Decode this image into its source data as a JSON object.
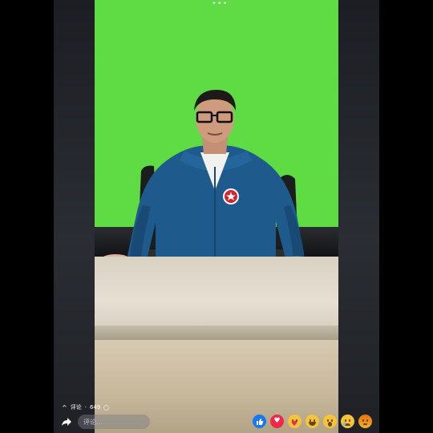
{
  "stats": {
    "chevron": "^",
    "comments_label": "评论",
    "separator": "·",
    "count": "649"
  },
  "comment_input": {
    "placeholder": "评论..."
  },
  "icons": {
    "menu": "more-dots-icon",
    "share": "share-arrow-icon",
    "reactions": [
      "like-icon",
      "love-icon",
      "care-icon",
      "haha-icon",
      "wow-icon",
      "sad-icon",
      "angry-icon"
    ]
  },
  "colors": {
    "green_screen": "#5fdb44",
    "like": "#1877f2",
    "love": "#f02849",
    "emoji": "#f7c33b"
  }
}
